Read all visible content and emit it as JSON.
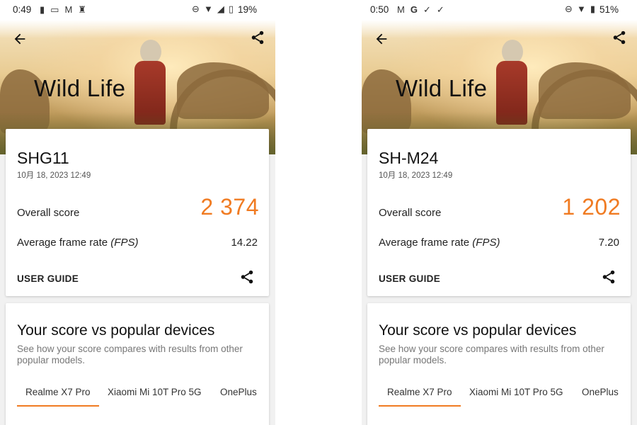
{
  "screens": [
    {
      "status": {
        "time": "0:49",
        "battery": "19%",
        "left_icons": [
          "battery-saver-icon",
          "voicemail-icon",
          "gmail-icon",
          "keyhole-icon"
        ],
        "right_icons": [
          "do-not-disturb-icon",
          "wifi-icon",
          "signal-icon",
          "battery-icon"
        ]
      },
      "hero_title": "Wild Life",
      "device": "SHG11",
      "date": "10月 18, 2023 12:49",
      "overall_label": "Overall score",
      "overall_value": "2 374",
      "fps_label": "Average frame rate",
      "fps_unit": "(FPS)",
      "fps_value": "14.22",
      "user_guide": "USER GUIDE",
      "compare_title": "Your score vs popular devices",
      "compare_sub": "See how your score compares with results from other popular models.",
      "tabs": [
        "Realme X7 Pro",
        "Xiaomi Mi 10T Pro 5G",
        "OnePlus"
      ]
    },
    {
      "status": {
        "time": "0:50",
        "battery": "51%",
        "left_icons": [
          "gmail-icon",
          "google-icon",
          "check-icon",
          "check-icon"
        ],
        "right_icons": [
          "do-not-disturb-icon",
          "wifi-icon",
          "battery-icon"
        ]
      },
      "hero_title": "Wild Life",
      "device": "SH-M24",
      "date": "10月 18, 2023 12:49",
      "overall_label": "Overall score",
      "overall_value": "1 202",
      "fps_label": "Average frame rate",
      "fps_unit": "(FPS)",
      "fps_value": "7.20",
      "user_guide": "USER GUIDE",
      "compare_title": "Your score vs popular devices",
      "compare_sub": "See how your score compares with results from other popular models.",
      "tabs": [
        "Realme X7 Pro",
        "Xiaomi Mi 10T Pro 5G",
        "OnePlus"
      ]
    }
  ],
  "colors": {
    "accent": "#f07b22",
    "background": "#f1f1f1",
    "card": "#ffffff"
  }
}
